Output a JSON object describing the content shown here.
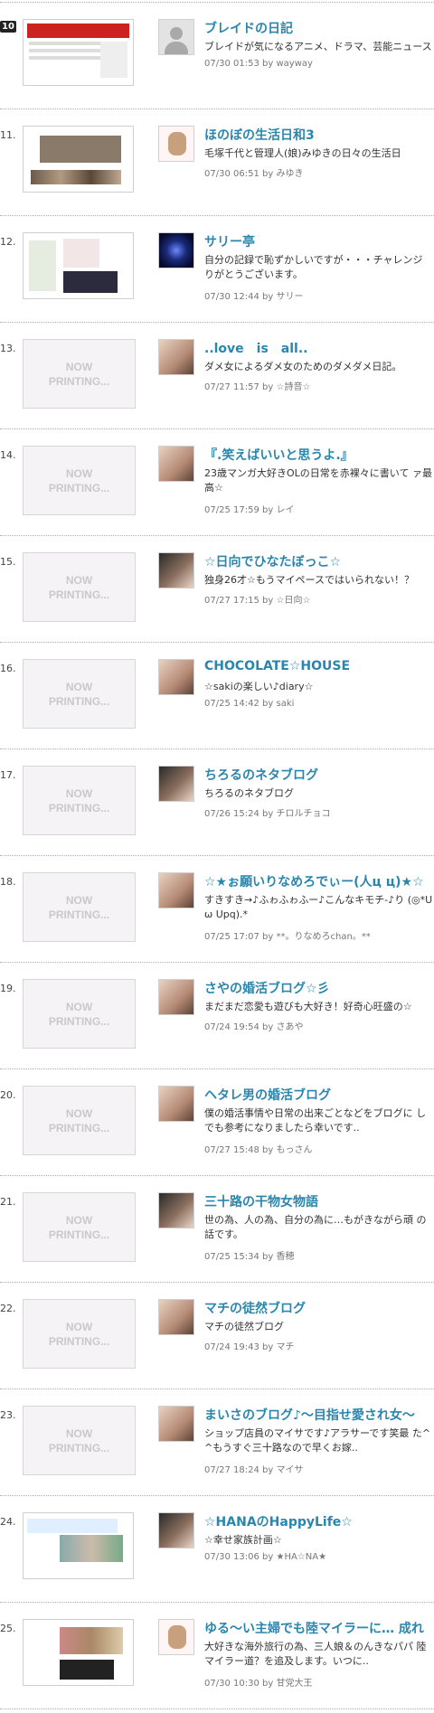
{
  "placeholder": {
    "line1": "NOW",
    "line2": "PRINTING..."
  },
  "entries": [
    {
      "rank": "10",
      "title": "ブレイドの日記",
      "desc": "ブレイドが気になるアニメ、ドラマ、芸能ニュース",
      "date": "07/30",
      "time": "01:53",
      "by": "by",
      "author": "wayway",
      "thumb": "red",
      "avatar": "default"
    },
    {
      "rank": "11.",
      "title": "ほのぼの生活日和3",
      "desc": "毛塚千代と管理人(娘)みゆきの日々の生活日",
      "date": "07/30",
      "time": "06:51",
      "by": "by",
      "author": "みゆき",
      "thumb": "photo",
      "avatar": "bear"
    },
    {
      "rank": "12.",
      "title": "サリー亭",
      "desc": "自分の記録で恥ずかしいですが・・・チャレンジ りがとうございます。",
      "date": "07/30",
      "time": "12:44",
      "by": "by",
      "author": "サリー",
      "thumb": "green",
      "avatar": "night"
    },
    {
      "rank": "13.",
      "title": "..love　is　all..",
      "desc": "ダメ女によるダメ女のためのダメダメ日記。",
      "date": "07/27",
      "time": "11:57",
      "by": "by",
      "author": "☆詩音☆",
      "thumb": "np",
      "avatar": "photo"
    },
    {
      "rank": "14.",
      "title": "『.笑えばいいと思うよ.』",
      "desc": "23歳マンガ大好きOLの日常を赤裸々に書いて ァ最高☆",
      "date": "07/25",
      "time": "17:59",
      "by": "by",
      "author": "レイ",
      "thumb": "np",
      "avatar": "photo"
    },
    {
      "rank": "15.",
      "title": "☆日向でひなたぼっこ☆",
      "desc": "独身26才☆もうマイペースではいられない！？",
      "date": "07/27",
      "time": "17:15",
      "by": "by",
      "author": "☆日向☆",
      "thumb": "np",
      "avatar": "dark"
    },
    {
      "rank": "16.",
      "title": "CHOCOLATE☆HOUSE",
      "desc": "☆sakiの楽しい♪diary☆",
      "date": "07/25",
      "time": "14:42",
      "by": "by",
      "author": "saki",
      "thumb": "np",
      "avatar": "photo"
    },
    {
      "rank": "17.",
      "title": "ちろるのネタブログ",
      "desc": "ちろるのネタブログ",
      "date": "07/26",
      "time": "15:24",
      "by": "by",
      "author": "チロルチョコ",
      "thumb": "np",
      "avatar": "dark"
    },
    {
      "rank": "18.",
      "title": "☆★ぉ願いりなめろでぃー(人ц ц)★☆",
      "desc": "すきすき→♪ふゎふゎふー♪こんなキモチ-♪り (◎*Uω Upq).*",
      "date": "07/25",
      "time": "17:07",
      "by": "by",
      "author": "**。りなめろchan。**",
      "thumb": "np",
      "avatar": "photo"
    },
    {
      "rank": "19.",
      "title": "さやの婚活ブログ☆彡",
      "desc": "まだまだ恋愛も遊びも大好き！好奇心旺盛の☆",
      "date": "07/24",
      "time": "19:54",
      "by": "by",
      "author": "さあや",
      "thumb": "np",
      "avatar": "photo"
    },
    {
      "rank": "20.",
      "title": "ヘタレ男の婚活ブログ",
      "desc": "僕の婚活事情や日常の出来ごとなどをブログに しでも参考になりましたら幸いです..",
      "date": "07/27",
      "time": "15:48",
      "by": "by",
      "author": "もっさん",
      "thumb": "np",
      "avatar": "photo"
    },
    {
      "rank": "21.",
      "title": "三十路の干物女物語",
      "desc": "世の為、人の為、自分の為に…もがきながら頑 の話です。",
      "date": "07/25",
      "time": "15:34",
      "by": "by",
      "author": "香穂",
      "thumb": "np",
      "avatar": "dark"
    },
    {
      "rank": "22.",
      "title": "マチの徒然ブログ",
      "desc": "マチの徒然ブログ",
      "date": "07/24",
      "time": "19:43",
      "by": "by",
      "author": "マチ",
      "thumb": "np",
      "avatar": "photo"
    },
    {
      "rank": "23.",
      "title": "まいさのブログ♪～目指せ愛され女～",
      "desc": "ショップ店員のマイサです♪アラサーです笑最 た^^もうすぐ三十路なので早くお嫁..",
      "date": "07/27",
      "time": "18:24",
      "by": "by",
      "author": "マイサ",
      "thumb": "np",
      "avatar": "photo"
    },
    {
      "rank": "24.",
      "title": "☆HANAのHappyLife☆",
      "desc": "☆幸せ家族計画☆",
      "date": "07/30",
      "time": "13:06",
      "by": "by",
      "author": "★HA☆NA★",
      "thumb": "hana",
      "avatar": "dark"
    },
    {
      "rank": "25.",
      "title": "ゆる～い主婦でも陸マイラーに… 成れ",
      "desc": "大好きな海外旅行の為、三人娘＆のんきなパパ 陸マイラー道？を追及します。いつに..",
      "date": "07/30",
      "time": "10:30",
      "by": "by",
      "author": "甘党大王",
      "thumb": "yuru",
      "avatar": "bear"
    }
  ]
}
